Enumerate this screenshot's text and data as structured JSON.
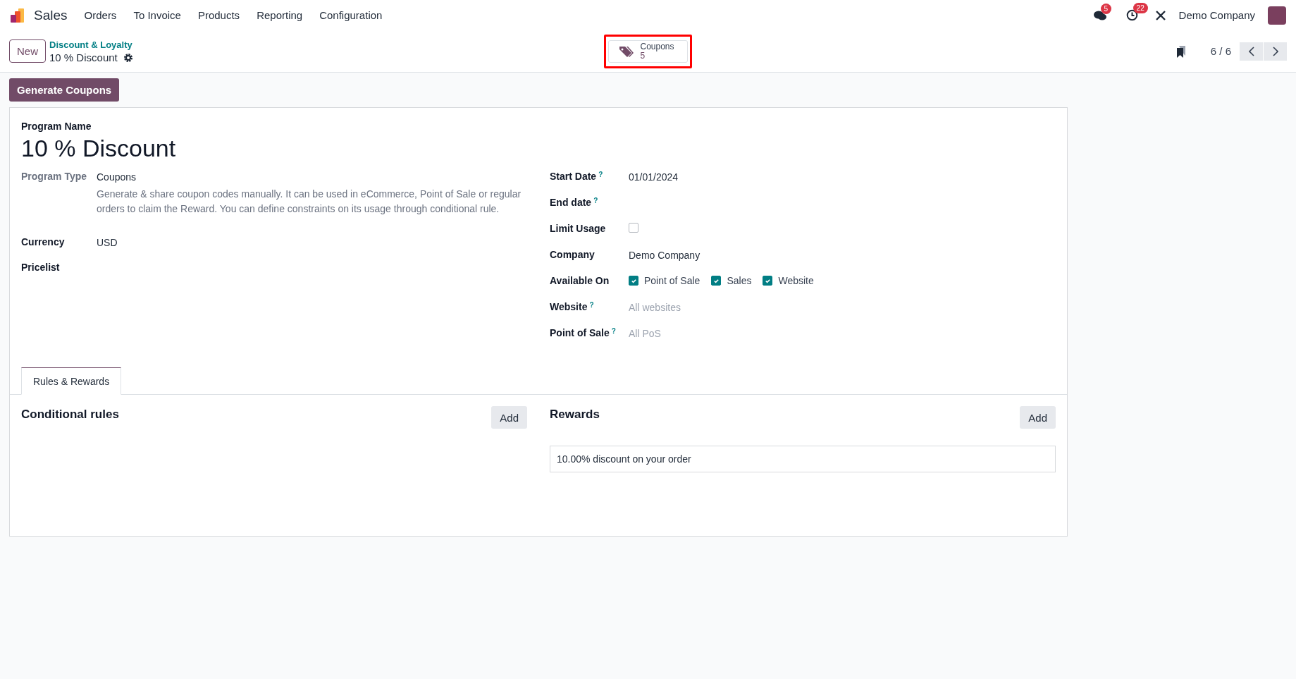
{
  "navbar": {
    "app_name": "Sales",
    "menu": [
      "Orders",
      "To Invoice",
      "Products",
      "Reporting",
      "Configuration"
    ],
    "messages_count": "5",
    "activities_count": "22",
    "company": "Demo Company"
  },
  "control_panel": {
    "new_button": "New",
    "breadcrumb": "Discount & Loyalty",
    "record": "10 % Discount",
    "smart_button": {
      "label": "Coupons",
      "count": "5",
      "highlighted": true
    },
    "pager": "6 / 6"
  },
  "action_button": "Generate Coupons",
  "form": {
    "name_label": "Program Name",
    "name": "10 % Discount",
    "left_fields": [
      {
        "label": "Program Type",
        "kind": "text",
        "value": "Coupons",
        "description": "Generate & share coupon codes manually. It can be used in eCommerce, Point of Sale or regular orders to claim the Reward. You can define constraints on its usage through conditional rule.",
        "muted": true
      },
      {
        "label": "Currency",
        "kind": "text",
        "value": "USD",
        "muted": false
      },
      {
        "label": "Pricelist",
        "kind": "text",
        "muted": false
      }
    ],
    "right_fields": [
      {
        "label": "Start Date",
        "help": "?",
        "kind": "text",
        "value": "01/01/2024"
      },
      {
        "label": "End date",
        "help": "?",
        "kind": "text"
      },
      {
        "label": "Limit Usage",
        "kind": "checkbox",
        "checked": false
      },
      {
        "label": "Company",
        "kind": "text",
        "value": "Demo Company"
      },
      {
        "label": "Available On",
        "kind": "checkgroup",
        "options": [
          {
            "label": "Point of Sale",
            "checked": true
          },
          {
            "label": "Sales",
            "checked": true
          },
          {
            "label": "Website",
            "checked": true
          }
        ]
      },
      {
        "label": "Website",
        "help": "?",
        "kind": "placeholder",
        "placeholder": "All websites"
      },
      {
        "label": "Point of Sale",
        "help": "?",
        "kind": "placeholder",
        "placeholder": "All PoS"
      }
    ],
    "tabs": [
      {
        "label": "Rules & Rewards",
        "selected": true
      }
    ],
    "conditional_rules": {
      "title": "Conditional rules",
      "add": "Add"
    },
    "rewards": {
      "title": "Rewards",
      "add": "Add",
      "items": [
        "10.00% discount on your order"
      ]
    }
  }
}
